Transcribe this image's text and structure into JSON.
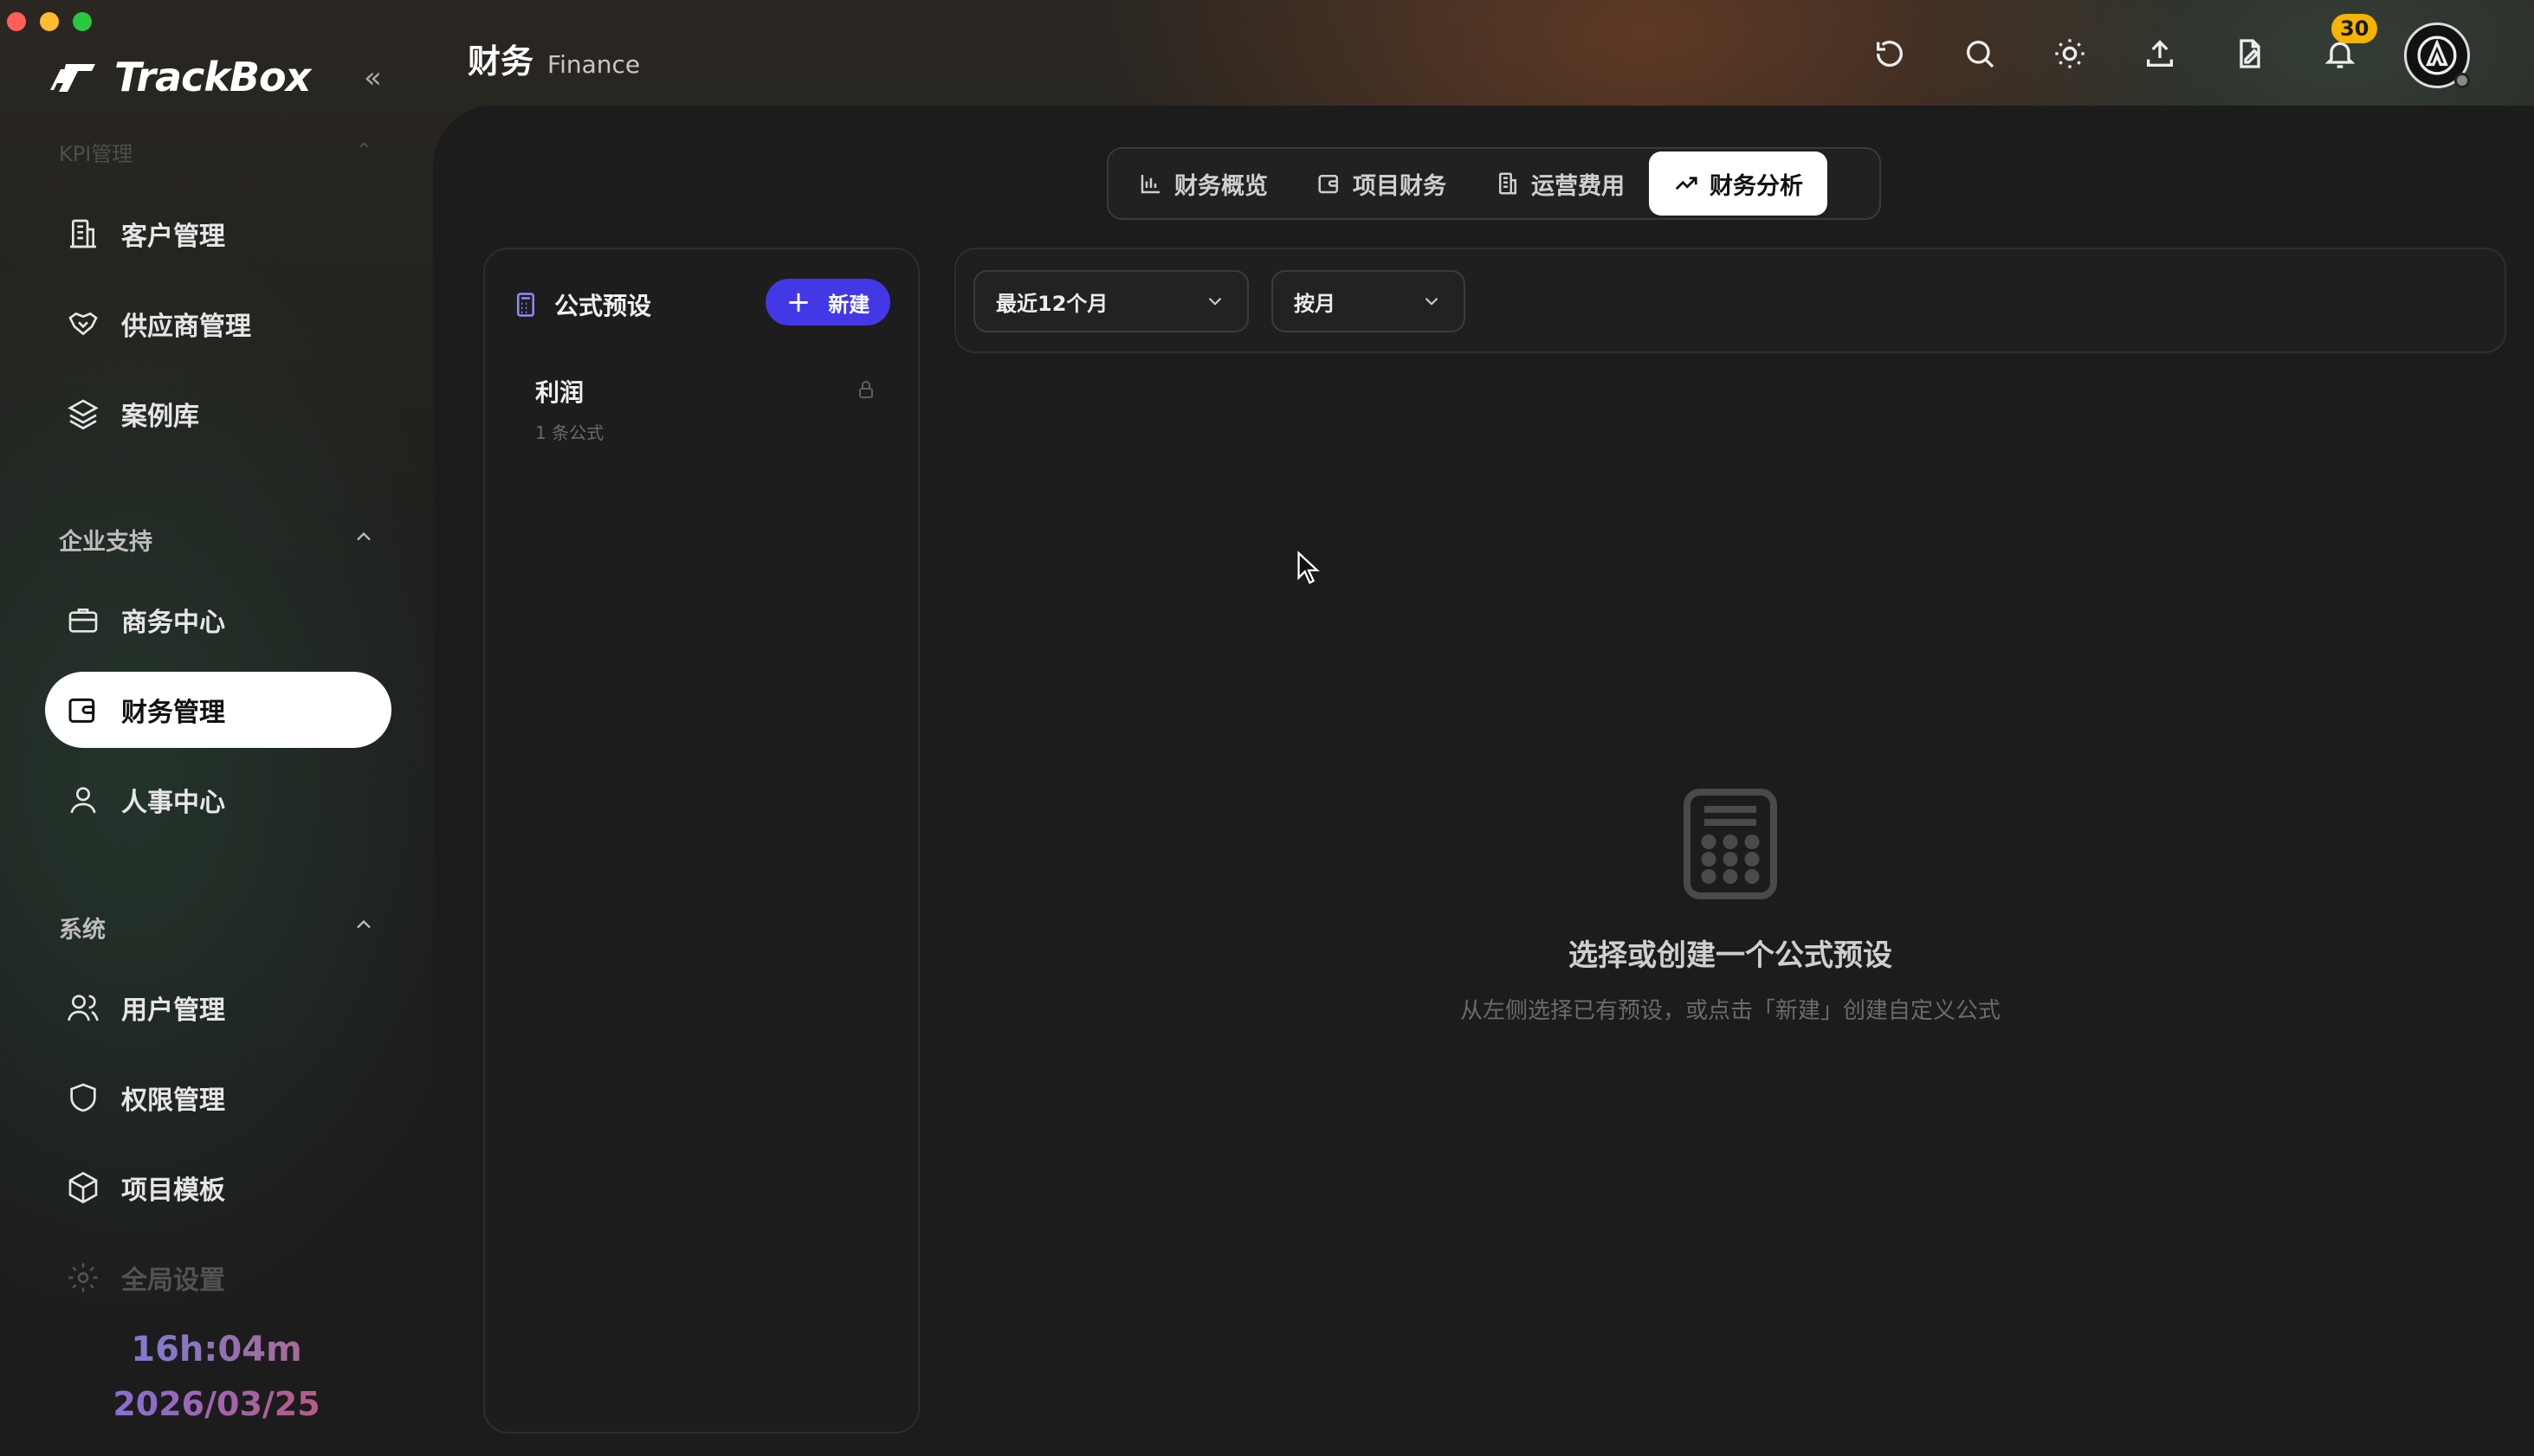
{
  "app": {
    "name": "TrackBox"
  },
  "sidebar": {
    "faded_section": "KPI管理",
    "items_top": [
      {
        "label": "客户管理",
        "icon": "building-icon"
      },
      {
        "label": "供应商管理",
        "icon": "handshake-icon"
      },
      {
        "label": "案例库",
        "icon": "layers-icon"
      }
    ],
    "section_enterprise": "企业支持",
    "items_enterprise": [
      {
        "label": "商务中心",
        "icon": "briefcase-icon"
      },
      {
        "label": "财务管理",
        "icon": "wallet-icon",
        "active": true
      },
      {
        "label": "人事中心",
        "icon": "person-icon"
      }
    ],
    "section_system": "系统",
    "items_system": [
      {
        "label": "用户管理",
        "icon": "users-icon"
      },
      {
        "label": "权限管理",
        "icon": "shield-icon"
      },
      {
        "label": "项目模板",
        "icon": "cube-icon"
      },
      {
        "label": "全局设置",
        "icon": "gear-icon"
      }
    ],
    "timer": "16h:04m",
    "date": "2026/03/25"
  },
  "header": {
    "title_zh": "财务",
    "title_en": "Finance",
    "notification_count": "30"
  },
  "tabs": [
    {
      "label": "财务概览",
      "icon": "bar-chart-icon"
    },
    {
      "label": "项目财务",
      "icon": "wallet-icon"
    },
    {
      "label": "运营费用",
      "icon": "building-icon"
    },
    {
      "label": "财务分析",
      "icon": "trend-icon",
      "active": true
    }
  ],
  "presets": {
    "title": "公式预设",
    "new_label": "新建",
    "items": [
      {
        "name": "利润",
        "sub": "1 条公式"
      }
    ]
  },
  "filters": {
    "range": "最近12个月",
    "granularity": "按月"
  },
  "empty_state": {
    "title": "选择或创建一个公式预设",
    "subtitle": "从左侧选择已有预设，或点击「新建」创建自定义公式"
  },
  "colors": {
    "accent": "#4338e6",
    "badge": "#f5b400",
    "active_bg": "#ffffff"
  }
}
